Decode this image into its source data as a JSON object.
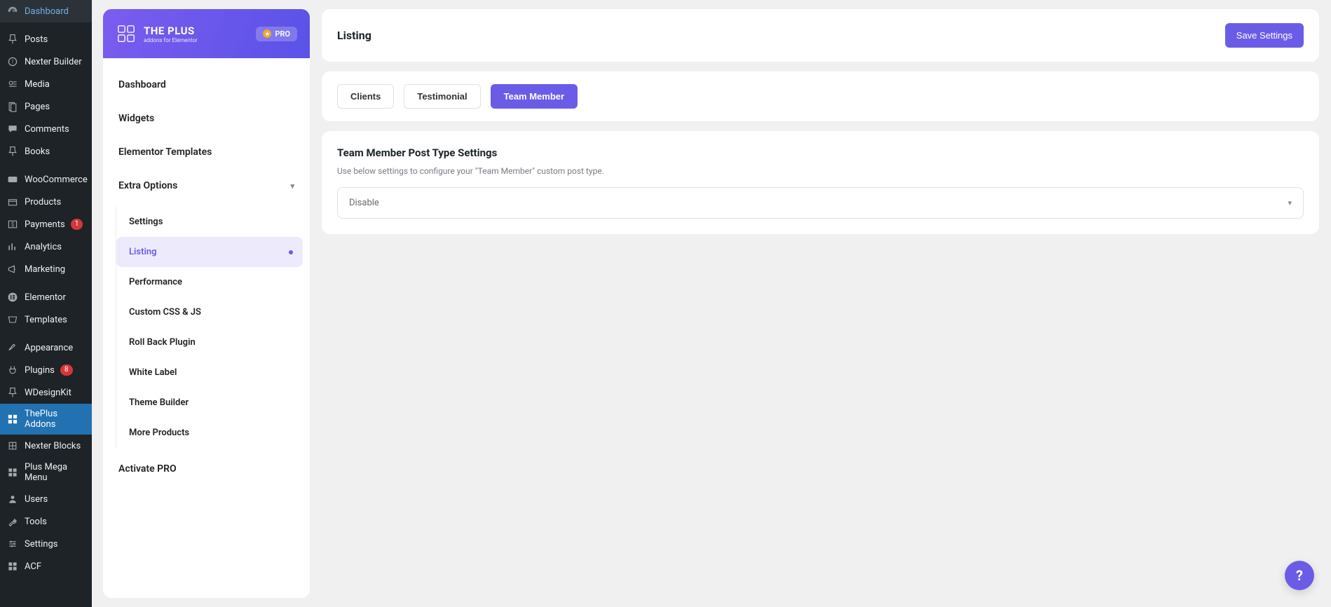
{
  "wp_sidebar": {
    "items": [
      {
        "label": "Dashboard",
        "icon": "gauge"
      },
      {
        "sep": true
      },
      {
        "label": "Posts",
        "icon": "pin"
      },
      {
        "label": "Nexter Builder",
        "icon": "circle-info"
      },
      {
        "label": "Media",
        "icon": "media"
      },
      {
        "label": "Pages",
        "icon": "page"
      },
      {
        "label": "Comments",
        "icon": "comment"
      },
      {
        "label": "Books",
        "icon": "pin"
      },
      {
        "sep": true
      },
      {
        "label": "WooCommerce",
        "icon": "woo"
      },
      {
        "label": "Products",
        "icon": "box"
      },
      {
        "label": "Payments",
        "icon": "dollar",
        "badge": "1"
      },
      {
        "label": "Analytics",
        "icon": "chart"
      },
      {
        "label": "Marketing",
        "icon": "megaphone"
      },
      {
        "sep": true
      },
      {
        "label": "Elementor",
        "icon": "elementor"
      },
      {
        "label": "Templates",
        "icon": "templates"
      },
      {
        "sep": true
      },
      {
        "label": "Appearance",
        "icon": "brush"
      },
      {
        "label": "Plugins",
        "icon": "plug",
        "badge": "8"
      },
      {
        "label": "WDesignKit",
        "icon": "pin"
      },
      {
        "label": "ThePlus Addons",
        "icon": "plus-grid",
        "active": true
      },
      {
        "label": "Nexter Blocks",
        "icon": "blocks"
      },
      {
        "label": "Plus Mega Menu",
        "icon": "grid"
      },
      {
        "label": "Users",
        "icon": "user"
      },
      {
        "label": "Tools",
        "icon": "wrench"
      },
      {
        "label": "Settings",
        "icon": "sliders"
      },
      {
        "label": "ACF",
        "icon": "grid"
      }
    ]
  },
  "plugin": {
    "logo_line1": "THE PLUS",
    "logo_line2": "addons for Elementor",
    "pro_label": "PRO",
    "nav": [
      {
        "label": "Dashboard"
      },
      {
        "label": "Widgets"
      },
      {
        "label": "Elementor Templates"
      },
      {
        "label": "Extra Options",
        "expanded": true,
        "children": [
          {
            "label": "Settings"
          },
          {
            "label": "Listing",
            "active": true
          },
          {
            "label": "Performance"
          },
          {
            "label": "Custom CSS & JS"
          },
          {
            "label": "Roll Back Plugin"
          },
          {
            "label": "White Label"
          },
          {
            "label": "Theme Builder"
          },
          {
            "label": "More Products"
          }
        ]
      },
      {
        "label": "Activate PRO"
      }
    ]
  },
  "content": {
    "header_title": "Listing",
    "save_button": "Save Settings",
    "tabs": [
      {
        "label": "Clients",
        "active": false
      },
      {
        "label": "Testimonial",
        "active": false
      },
      {
        "label": "Team Member",
        "active": true
      }
    ],
    "section_title": "Team Member Post Type Settings",
    "section_desc": "Use below settings to configure your \"Team Member\" custom post type.",
    "select_value": "Disable"
  },
  "help_fab": "?"
}
